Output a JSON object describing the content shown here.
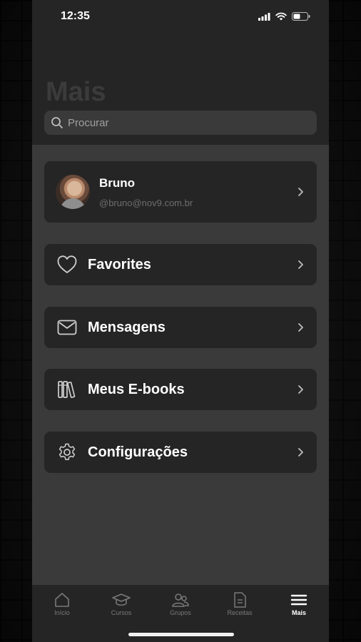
{
  "status": {
    "time": "12:35"
  },
  "page": {
    "title": "Mais"
  },
  "search": {
    "placeholder": "Procurar"
  },
  "profile": {
    "name": "Bruno",
    "handle": "@bruno@nov9.com.br"
  },
  "menu": [
    {
      "label": "Favorites",
      "icon": "heart-icon"
    },
    {
      "label": "Mensagens",
      "icon": "envelope-icon"
    },
    {
      "label": "Meus E-books",
      "icon": "books-icon"
    },
    {
      "label": "Configurações",
      "icon": "gear-icon"
    }
  ],
  "tabs": [
    {
      "label": "Início",
      "icon": "home-icon",
      "active": false
    },
    {
      "label": "Cursos",
      "icon": "graduation-cap-icon",
      "active": false
    },
    {
      "label": "Grupos",
      "icon": "group-icon",
      "active": false
    },
    {
      "label": "Receitas",
      "icon": "document-icon",
      "active": false
    },
    {
      "label": "Mais",
      "icon": "menu-icon",
      "active": true
    }
  ],
  "colors": {
    "accent": "#ffffff",
    "card": "#252525",
    "page": "#3a3a3a"
  }
}
